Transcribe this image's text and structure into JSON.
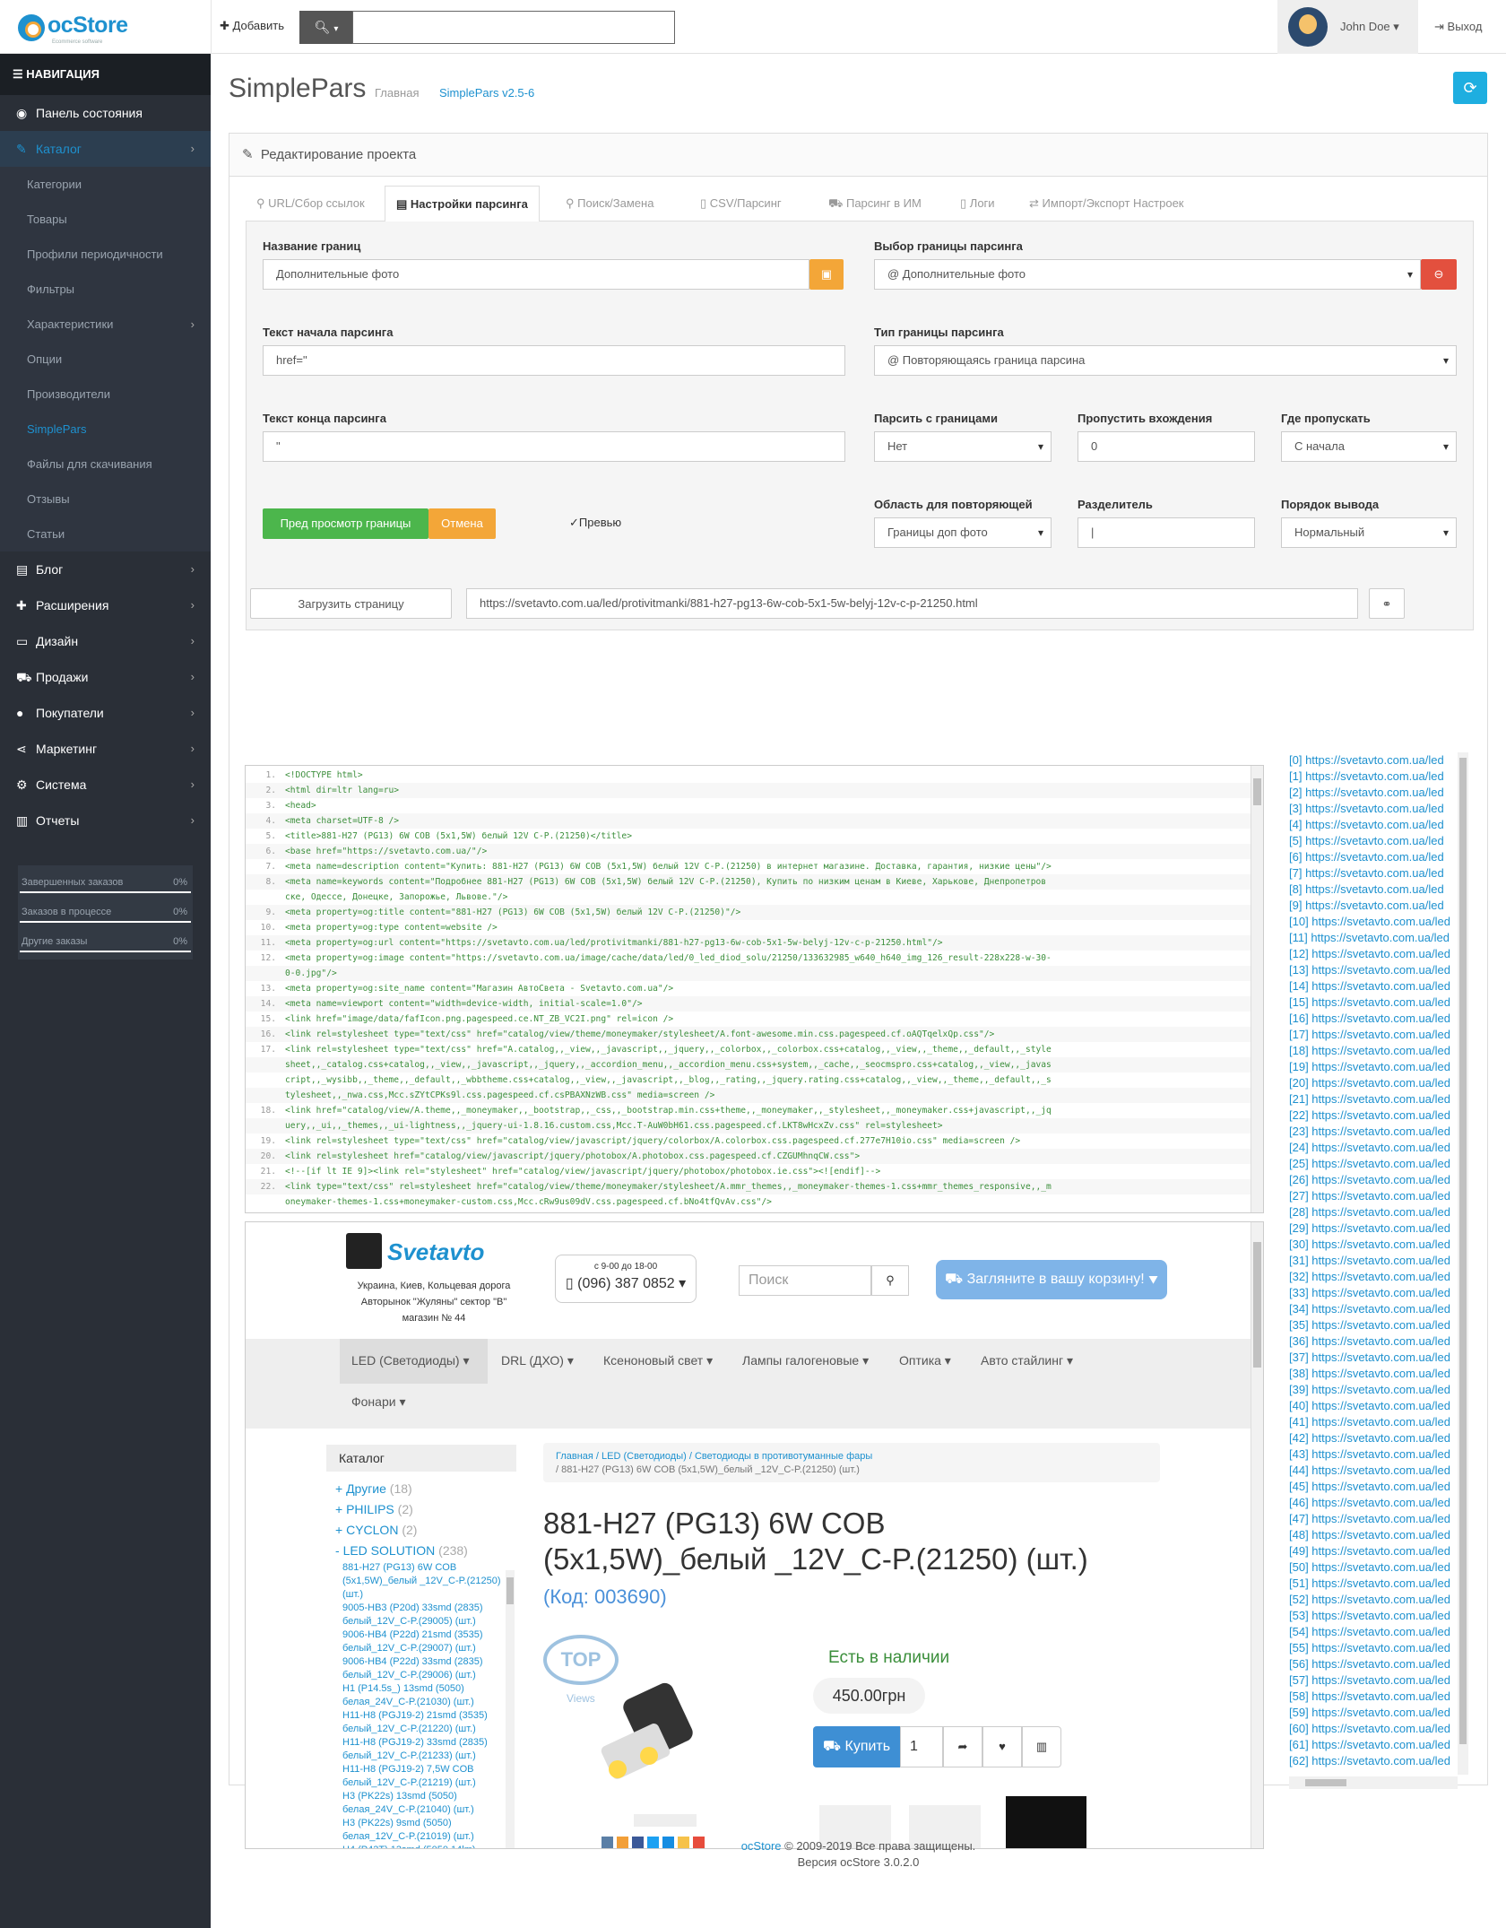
{
  "header": {
    "logo": "ocStore",
    "logo_sub": "Ecommerce software",
    "add": "Добавить",
    "user": "John Doe",
    "logout": "Выход"
  },
  "sidebar": {
    "title": "НАВИГАЦИЯ",
    "items": [
      {
        "label": "Панель состояния",
        "icon": "dashboard-icon"
      },
      {
        "label": "Каталог",
        "icon": "tag-icon"
      },
      {
        "label": "Блог",
        "icon": "book-icon"
      },
      {
        "label": "Расширения",
        "icon": "puzzle-icon"
      },
      {
        "label": "Дизайн",
        "icon": "desktop-icon"
      },
      {
        "label": "Продажи",
        "icon": "cart-icon"
      },
      {
        "label": "Покупатели",
        "icon": "user-icon"
      },
      {
        "label": "Маркетинг",
        "icon": "share-icon"
      },
      {
        "label": "Система",
        "icon": "cog-icon"
      },
      {
        "label": "Отчеты",
        "icon": "bar-chart-icon"
      }
    ],
    "catalog_sub": [
      "Категории",
      "Товары",
      "Профили периодичности",
      "Фильтры",
      "Характеристики",
      "Опции",
      "Производители",
      "SimplePars",
      "Файлы для скачивания",
      "Отзывы",
      "Статьи"
    ],
    "stats": [
      {
        "label": "Завершенных заказов",
        "value": "0%"
      },
      {
        "label": "Заказов в процессе",
        "value": "0%"
      },
      {
        "label": "Другие заказы",
        "value": "0%"
      }
    ]
  },
  "page": {
    "title": "SimplePars",
    "bc_home": "Главная",
    "bc_current": "SimplePars v2.5-6",
    "panel_title": "Редактирование проекта"
  },
  "tabs": [
    "URL/Сбор ссылок",
    "Настройки парсинга",
    "Поиск/Замена",
    "CSV/Парсинг",
    "Парсинг в ИМ",
    "Логи",
    "Импорт/Экспорт Настроек"
  ],
  "form": {
    "name_label": "Название границ",
    "name_value": "Дополнительные фото",
    "select_label": "Выбор границы парсинга",
    "select_value": "@ Дополнительные фото",
    "start_label": "Текст начала парсинга",
    "start_value": "href=\"",
    "type_label": "Тип границы парсинга",
    "type_value": "@ Повторяющаясь граница парсина",
    "end_label": "Текст конца парсинга",
    "end_value": "\"",
    "with_bounds_label": "Парсить с границами",
    "with_bounds_value": "Нет",
    "skip_label": "Пропустить вхождения",
    "skip_value": "0",
    "where_skip_label": "Где пропускать",
    "where_skip_value": "С начала",
    "preview_btn": "Пред просмотр границы",
    "cancel_btn": "Отмена",
    "preview_check": "Превью",
    "area_label": "Область для повторяющей",
    "area_value": "Границы доп фото",
    "sep_label": "Разделитель",
    "sep_value": "|",
    "order_label": "Порядок вывода",
    "order_value": "Нормальный",
    "load_btn": "Загрузить страницу",
    "url_value": "https://svetavto.com.ua/led/protivitmanki/881-h27-pg13-6w-cob-5x1-5w-belyj-12v-c-p-21250.html"
  },
  "code_lines": [
    "<!DOCTYPE html>",
    "<html dir=ltr lang=ru>",
    "<head>",
    "<meta charset=UTF-8 />",
    "<title>881-H27 (PG13) 6W COB (5x1,5W) белый 12V C-P.(21250)</title>",
    "<base href=\"https://svetavto.com.ua/\"/>",
    "<meta name=description content=\"Купить: 881-H27 (PG13) 6W COB (5x1,5W) белый 12V C-P.(21250) в интернет магазине. Доставка, гарантия, низкие цены\"/>",
    "<meta name=keywords content=\"Подробнее 881-H27 (PG13) 6W COB (5x1,5W) белый 12V C-P.(21250), Купить по низким ценам в Киеве, Харькове, Днепропетров",
    "ске, Одессе, Донецке, Запорожье, Львове.\"/>",
    "<meta property=og:title content=\"881-H27 (PG13) 6W COB (5x1,5W) белый 12V C-P.(21250)\"/>",
    "<meta property=og:type content=website />",
    "<meta property=og:url content=\"https://svetavto.com.ua/led/protivitmanki/881-h27-pg13-6w-cob-5x1-5w-belyj-12v-c-p-21250.html\"/>",
    "<meta property=og:image content=\"https://svetavto.com.ua/image/cache/data/led/0_led_diod_solu/21250/133632985_w640_h640_img_126_result-228x228-w-30-",
    "0-0.jpg\"/>",
    "<meta property=og:site_name content=\"Магазин АвтоСвета - Svetavto.com.ua\"/>",
    "<meta name=viewport content=\"width=device-width, initial-scale=1.0\"/>",
    "<link href=\"image/data/fafIcon.png.pagespeed.ce.NT_ZB_VC2I.png\" rel=icon />",
    "<link rel=stylesheet type=\"text/css\" href=\"catalog/view/theme/moneymaker/stylesheet/A.font-awesome.min.css.pagespeed.cf.oAQTqelxQp.css\"/>",
    "<link rel=stylesheet type=\"text/css\" href=\"A.catalog,,_view,,_javascript,,_jquery,,_colorbox,,_colorbox.css+catalog,,_view,,_theme,,_default,,_style",
    "sheet,,_catalog.css+catalog,,_view,,_javascript,,_jquery,,_accordion_menu,,_accordion_menu.css+system,,_cache,,_seocmspro.css+catalog,,_view,,_javas",
    "cript,,_wysibb,,_theme,,_default,,_wbbtheme.css+catalog,,_view,,_javascript,,_blog,,_rating,,_jquery.rating.css+catalog,,_view,,_theme,,_default,,_s",
    "tylesheet,,_nwa.css,Mcc.sZYtCPKs9l.css.pagespeed.cf.csPBAXNzWB.css\" media=screen />",
    "<link href=\"catalog/view/A.theme,,_moneymaker,,_bootstrap,,_css,,_bootstrap.min.css+theme,,_moneymaker,,_stylesheet,,_moneymaker.css+javascript,,_jq",
    "uery,,_ui,,_themes,,_ui-lightness,,_jquery-ui-1.8.16.custom.css,Mcc.T-AuW0bH61.css.pagespeed.cf.LKT8wHcxZv.css\" rel=stylesheet>",
    "<link rel=stylesheet type=\"text/css\" href=\"catalog/view/javascript/jquery/colorbox/A.colorbox.css.pagespeed.cf.277e7H10io.css\" media=screen />",
    "<link rel=stylesheet href=\"catalog/view/javascript/jquery/photobox/A.photobox.css.pagespeed.cf.CZGUMhnqCW.css\">",
    "<!--[if lt IE 9]><link rel=\"stylesheet\" href=\"catalog/view/javascript/jquery/photobox/photobox.ie.css\"><![endif]-->",
    "<link type=\"text/css\" rel=stylesheet href=\"catalog/view/theme/moneymaker/stylesheet/A.mmr_themes,,_moneymaker-themes-1.css+mmr_themes_responsive,,_m",
    "oneymaker-themes-1.css+moneymaker-custom.css,Mcc.cRw9us09dV.css.pagespeed.cf.bNo4tfQvAv.css\"/>"
  ],
  "code_line_numbers": [
    "1.",
    "2.",
    "3.",
    "4.",
    "5.",
    "6.",
    "7.",
    "8.",
    "",
    "9.",
    "10.",
    "11.",
    "12.",
    "",
    "13.",
    "14.",
    "15.",
    "16.",
    "17.",
    "",
    "",
    "",
    "18.",
    "",
    "19.",
    "20.",
    "21.",
    "22.",
    ""
  ],
  "preview": {
    "brand": "Svetavto",
    "address": [
      "Украина, Киев, Кольцевая дорога",
      "Авторынок \"Жуляны\" сектор \"В\"",
      "магазин № 44"
    ],
    "hours": "с 9-00 до 18-00",
    "phone": "(096) 387 0852",
    "search_ph": "Поиск",
    "cart": "Загляните в вашу корзину!",
    "nav": [
      "LED (Светодиоды)",
      "DRL (ДХО)",
      "Ксеноновый свет",
      "Лампы галогеновые",
      "Оптика",
      "Авто стайлинг",
      "Фонари"
    ],
    "catalog_title": "Каталог",
    "cats": [
      {
        "name": "Другие",
        "count": "(18)"
      },
      {
        "name": "PHILIPS",
        "count": "(2)"
      },
      {
        "name": "CYCLON",
        "count": "(2)"
      },
      {
        "name": "LED SOLUTION",
        "count": "(238)"
      }
    ],
    "cat_items": [
      "881-H27 (PG13) 6W COB",
      "(5x1,5W)_белый _12V_C-P.(21250)",
      "(шт.)",
      "9005-HB3 (P20d) 33smd (2835)",
      "белый_12V_C-P.(29005) (шт.)",
      "9006-HB4 (P22d) 21smd (3535)",
      "белый_12V_C-P.(29007) (шт.)",
      "9006-HB4 (P22d) 33smd (2835)",
      "белый_12V_C-P.(29006) (шт.)",
      "H1 (P14.5s_) 13smd (5050)",
      "белая_24V_C-P.(21030) (шт.)",
      "H11-H8 (PGJ19-2) 21smd (3535)",
      "белый_12V_C-P.(21220) (шт.)",
      "H11-H8 (PGJ19-2) 33smd (2835)",
      "белый_12V_C-P.(21233) (шт.)",
      "H11-H8 (PGJ19-2) 7,5W COB",
      "белый_12V_C-P.(21219) (шт.)",
      "H3 (PK22s) 13smd (5050)",
      "белая_24V_C-P.(21040) (шт.)",
      "H3 (PK22s) 9smd (5050)",
      "белая_12V_C-P.(21019) (шт.)",
      "H4 (P43T) 13smd (5050 14lm)"
    ],
    "bc": [
      "Главная",
      "LED (Светодиоды)",
      "Светодиоды в противотуманные фары"
    ],
    "bc2": "881-H27 (PG13) 6W COB (5x1,5W)_белый _12V_C-P.(21250) (шт.)",
    "title_l1": "881-H27 (PG13) 6W COB",
    "title_l2": "(5x1,5W)_белый _12V_C-P.(21250) (шт.)",
    "code": "(Код: 003690)",
    "instock": "Есть в наличии",
    "price": "450.00грн",
    "buy": "Купить",
    "qty": "1",
    "views": "Views",
    "top": "TOP"
  },
  "links_prefix": "https://svetavto.com.ua/led",
  "links_count": 63,
  "footer": {
    "brand": "ocStore",
    "copy": "© 2009-2019 Все права защищены.",
    "version": "Версия ocStore 3.0.2.0"
  }
}
